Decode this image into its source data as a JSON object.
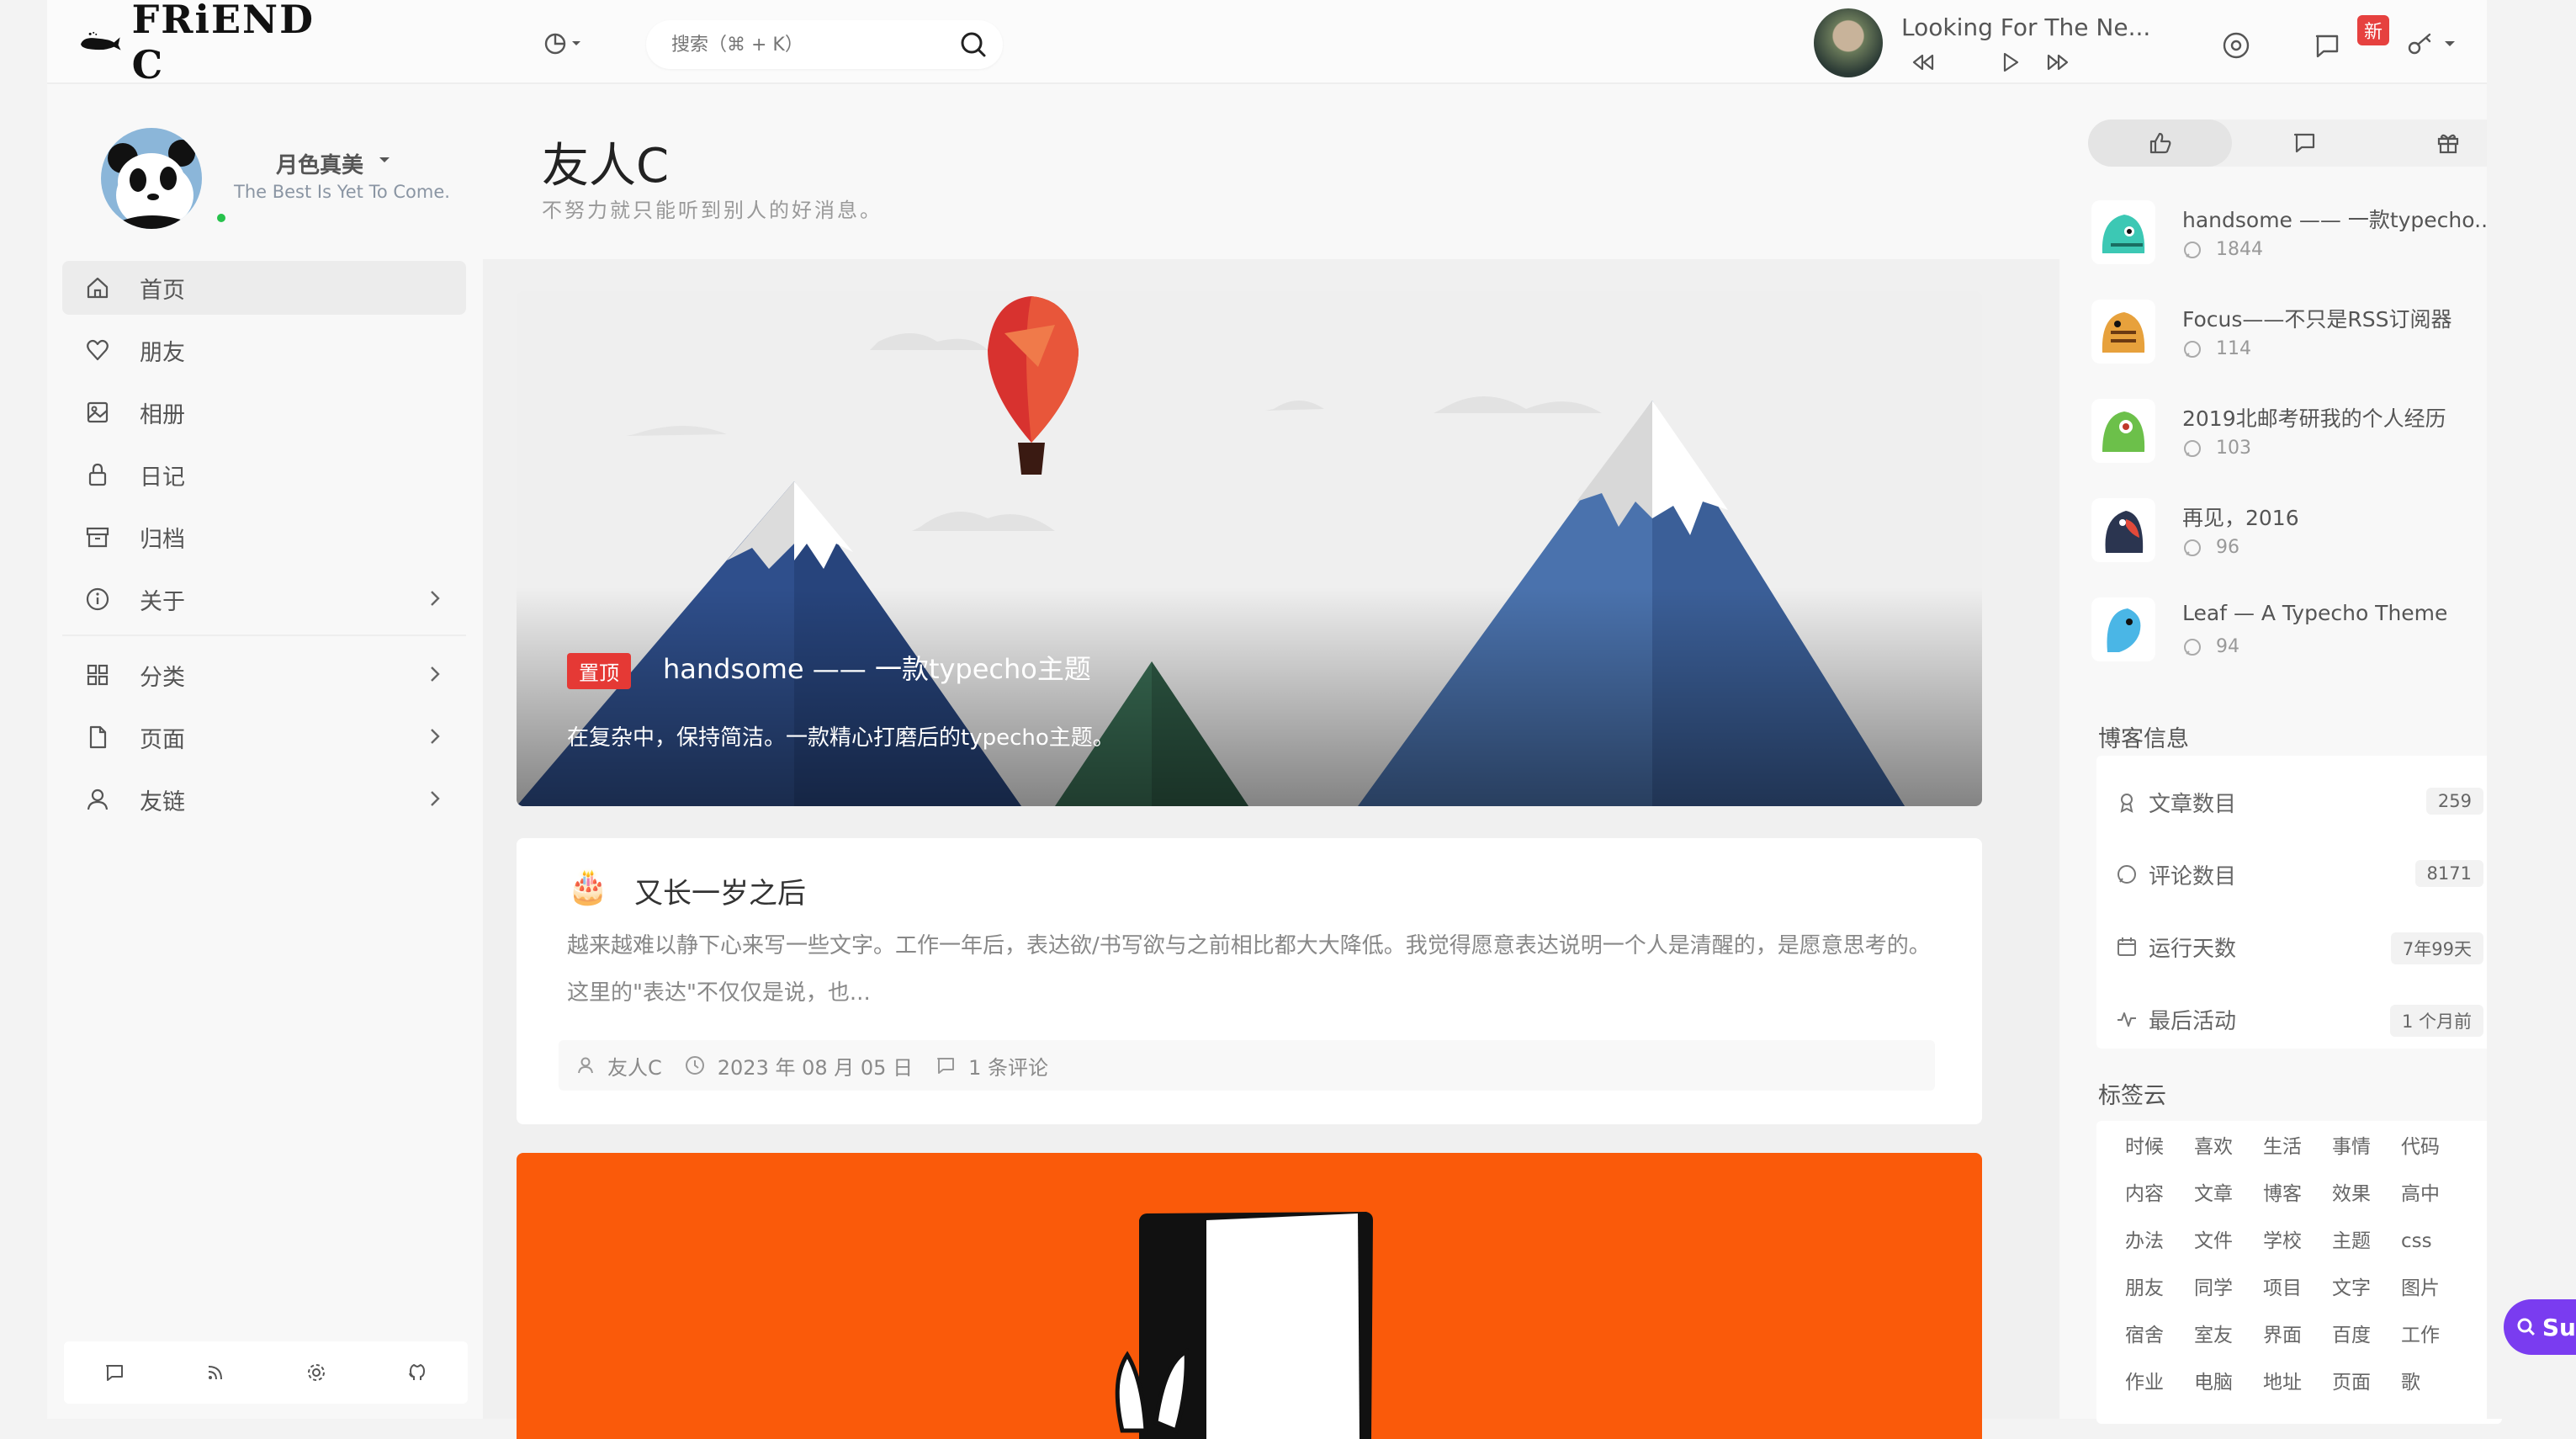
{
  "header": {
    "logo_text": "FRiEND C",
    "search_placeholder": "搜索（⌘ + K）",
    "player_title": "Looking For The Ne...",
    "notification_badge": "新"
  },
  "profile": {
    "name": "月色真美",
    "motto": "The Best Is Yet To Come."
  },
  "nav": {
    "items": [
      {
        "label": "首页"
      },
      {
        "label": "朋友"
      },
      {
        "label": "相册"
      },
      {
        "label": "日记"
      },
      {
        "label": "归档"
      },
      {
        "label": "关于"
      },
      {
        "label": "分类"
      },
      {
        "label": "页面"
      },
      {
        "label": "友链"
      }
    ]
  },
  "page": {
    "title": "友人C",
    "subtitle": "不努力就只能听到别人的好消息。"
  },
  "hero": {
    "badge": "置顶",
    "title": "handsome —— 一款typecho主题",
    "desc": "在复杂中，保持简洁。一款精心打磨后的typecho主题。"
  },
  "post": {
    "emoji": "🎂",
    "title": "又长一岁之后",
    "excerpt": "越来越难以静下心来写一些文字。工作一年后，表达欲/书写欲与之前相比都大大降低。我觉得愿意表达说明一个人是清醒的，是愿意思考的。这里的\"表达\"不仅仅是说，也...",
    "author": "友人C",
    "date": "2023 年 08 月 05 日",
    "comments": "1 条评论"
  },
  "hot": {
    "items": [
      {
        "title": "handsome —— 一款typecho...",
        "count": "1844"
      },
      {
        "title": "Focus——不只是RSS订阅器",
        "count": "114"
      },
      {
        "title": "2019北邮考研我的个人经历",
        "count": "103"
      },
      {
        "title": "再见，2016",
        "count": "96"
      },
      {
        "title": "Leaf — A Typecho Theme",
        "count": "94"
      }
    ]
  },
  "blog_info": {
    "title": "博客信息",
    "rows": [
      {
        "label": "文章数目",
        "value": "259"
      },
      {
        "label": "评论数目",
        "value": "8171"
      },
      {
        "label": "运行天数",
        "value": "7年99天"
      },
      {
        "label": "最后活动",
        "value": "1 个月前"
      }
    ]
  },
  "tag_cloud": {
    "title": "标签云",
    "tags": [
      "时候",
      "喜欢",
      "生活",
      "事情",
      "代码",
      "内容",
      "文章",
      "博客",
      "效果",
      "高中",
      "办法",
      "文件",
      "学校",
      "主题",
      "css",
      "朋友",
      "同学",
      "项目",
      "文字",
      "图片",
      "宿舍",
      "室友",
      "界面",
      "百度",
      "工作",
      "作业",
      "电脑",
      "地址",
      "页面",
      "歌"
    ]
  },
  "float_button": {
    "label": "Su"
  },
  "colors": {
    "accent_red": "#e53935",
    "online": "#27c24c",
    "orange_card": "#fa5a0a"
  }
}
